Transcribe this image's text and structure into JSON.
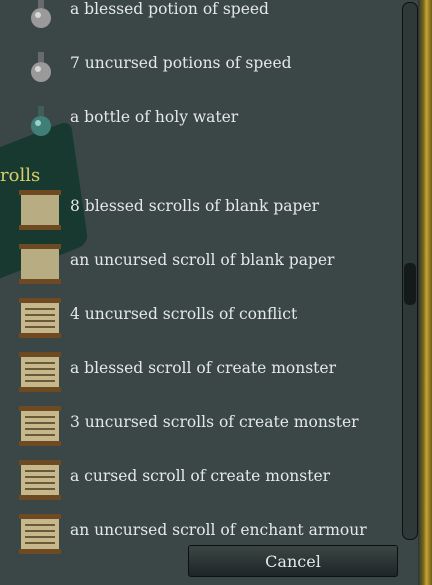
{
  "section_label": "rolls",
  "items": [
    {
      "text": "a blessed potion of speed",
      "icon": "potion-grey"
    },
    {
      "text": "7 uncursed potions of speed",
      "icon": "potion-grey"
    },
    {
      "text": "a bottle of holy water",
      "icon": "potion-teal"
    },
    {
      "text": "8 blessed scrolls of blank paper",
      "icon": "scroll-blank"
    },
    {
      "text": "an uncursed scroll of blank paper",
      "icon": "scroll-blank"
    },
    {
      "text": "4 uncursed scrolls of conflict",
      "icon": "scroll-written"
    },
    {
      "text": "a blessed scroll of create monster",
      "icon": "scroll-written"
    },
    {
      "text": "3 uncursed scrolls of create monster",
      "icon": "scroll-written"
    },
    {
      "text": "a cursed scroll of create monster",
      "icon": "scroll-written"
    },
    {
      "text": "an uncursed scroll of enchant armour",
      "icon": "scroll-written"
    }
  ],
  "cancel_label": "Cancel",
  "colors": {
    "panel": "#3b4746",
    "text": "#e6e8e8",
    "label": "#d8cf6a",
    "accent": "#c9a431"
  }
}
